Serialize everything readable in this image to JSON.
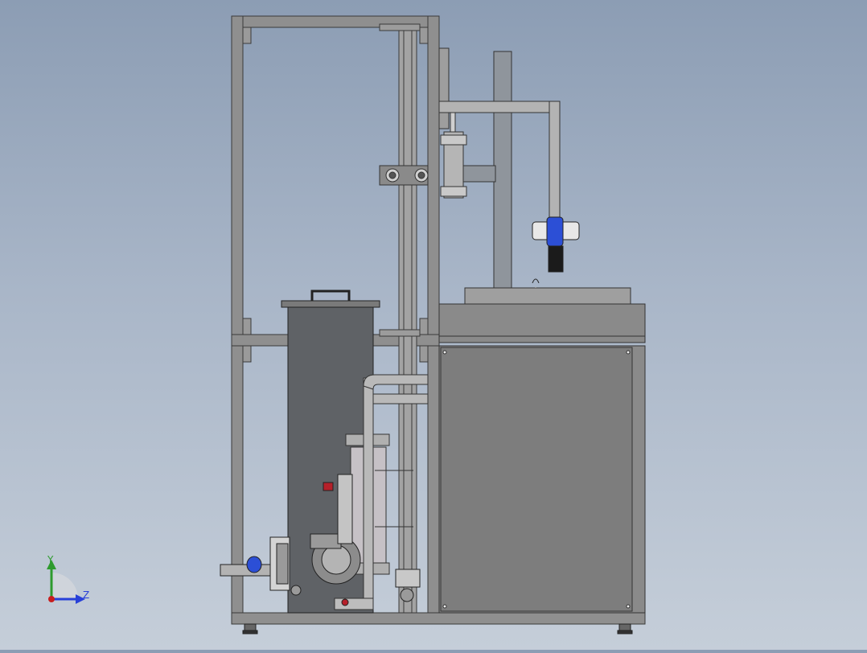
{
  "viewport": {
    "background_top": "#8c9db4",
    "background_bottom": "#c5ced9"
  },
  "triad": {
    "y_label": "Y",
    "z_label": "Z",
    "y_color": "#2e9b2e",
    "z_color": "#2840d8",
    "x_color": "#c81e1e"
  },
  "colors": {
    "frame": "#8f8f8f",
    "frame_edge": "#3a3a3a",
    "cabinet": "#7d7d7d",
    "tank": "#5f6266",
    "pipe": "#b9b9b9",
    "valve_blue": "#2c4fd6",
    "valve_red": "#b5202a"
  }
}
